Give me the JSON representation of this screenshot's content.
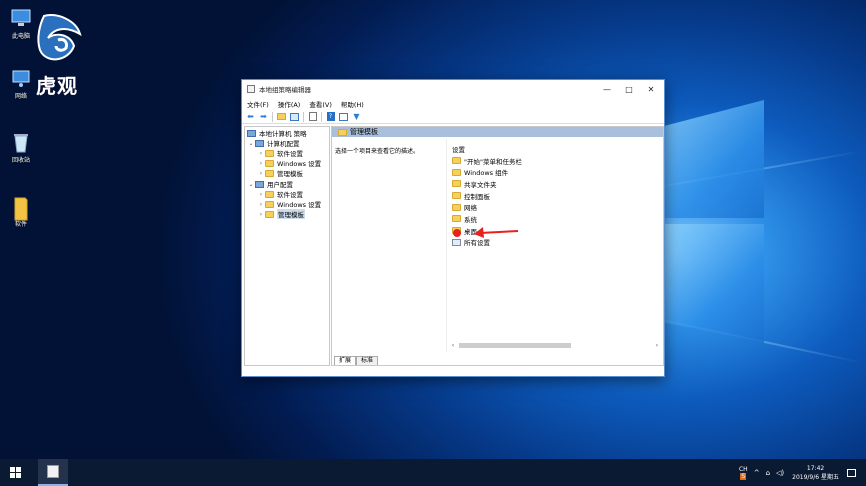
{
  "desktop": {
    "icons": [
      {
        "label": "此电脑",
        "icon": "computer-icon"
      },
      {
        "label": "网络",
        "icon": "network-icon"
      },
      {
        "label": "回收站",
        "icon": "recycle-bin-icon"
      },
      {
        "label": "软件",
        "icon": "folder-icon"
      }
    ],
    "watermark": "虎观"
  },
  "window": {
    "title": "本地组策略编辑器",
    "controls": {
      "minimize": "—",
      "maximize": "□",
      "close": "✕"
    },
    "menu": [
      "文件(F)",
      "操作(A)",
      "查看(V)",
      "帮助(H)"
    ],
    "tree": {
      "root": "本地计算机 策略",
      "computer": "计算机配置",
      "computer_children": [
        "软件设置",
        "Windows 设置",
        "管理模板"
      ],
      "user": "用户配置",
      "user_children": [
        "软件设置",
        "Windows 设置",
        "管理模板"
      ]
    },
    "header": "管理模板",
    "description": "选择一个项目来查看它的描述。",
    "list_header": "设置",
    "list_items": [
      "\"开始\"菜单和任务栏",
      "Windows 组件",
      "共享文件夹",
      "控制面板",
      "网络",
      "系统",
      "桌面",
      "所有设置"
    ],
    "tabs": [
      "扩展",
      "标准"
    ]
  },
  "taskbar": {
    "ime": "CH",
    "ime_sub": "S",
    "time": "17:42",
    "date": "2019/9/6 星期五"
  },
  "colors": {
    "accent": "#0078d7",
    "arrow": "#e8211c",
    "header_bar": "#a9bfdc"
  }
}
